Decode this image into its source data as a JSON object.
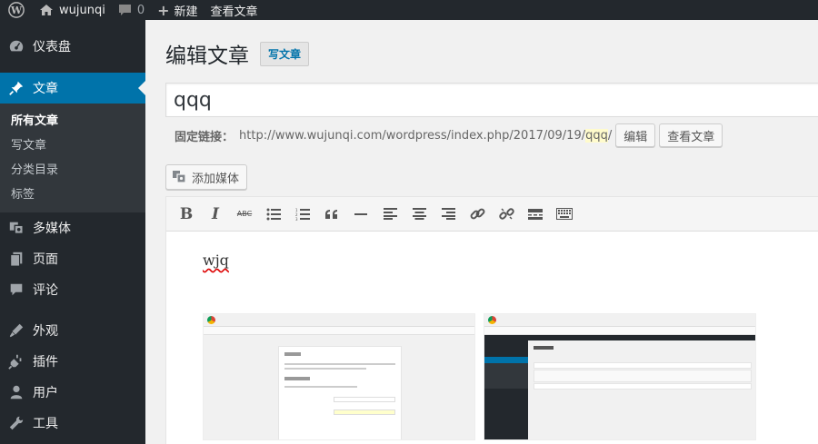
{
  "adminbar": {
    "site_name": "wujunqi",
    "comments_count": "0",
    "new_label": "新建",
    "view_post_label": "查看文章"
  },
  "sidebar": {
    "items": [
      {
        "label": "仪表盘",
        "icon": "dashboard-icon"
      },
      {
        "label": "文章",
        "icon": "pushpin-icon"
      },
      {
        "label": "多媒体",
        "icon": "media-icon"
      },
      {
        "label": "页面",
        "icon": "page-icon"
      },
      {
        "label": "评论",
        "icon": "comment-icon"
      },
      {
        "label": "外观",
        "icon": "appearance-icon"
      },
      {
        "label": "插件",
        "icon": "plugin-icon"
      },
      {
        "label": "用户",
        "icon": "user-icon"
      },
      {
        "label": "工具",
        "icon": "tools-icon"
      }
    ],
    "submenu": [
      "所有文章",
      "写文章",
      "分类目录",
      "标签"
    ]
  },
  "main": {
    "page_title": "编辑文章",
    "add_new_label": "写文章",
    "post_title": "qqq",
    "permalink_label": "固定链接：",
    "permalink_base": "http://www.wujunqi.com/wordpress/index.php/2017/09/19/",
    "permalink_slug": "qqq",
    "permalink_trailing": "/",
    "edit_button": "编辑",
    "view_button": "查看文章",
    "add_media_label": "添加媒体",
    "content_text": "wjq"
  },
  "toolbar": {
    "bold": "B",
    "italic": "I",
    "strike": "ABC"
  },
  "colors": {
    "adminbar_bg": "#23282d",
    "accent": "#0073aa",
    "submenu_bg": "#32373c",
    "slug_highlight": "#fffbcc"
  }
}
